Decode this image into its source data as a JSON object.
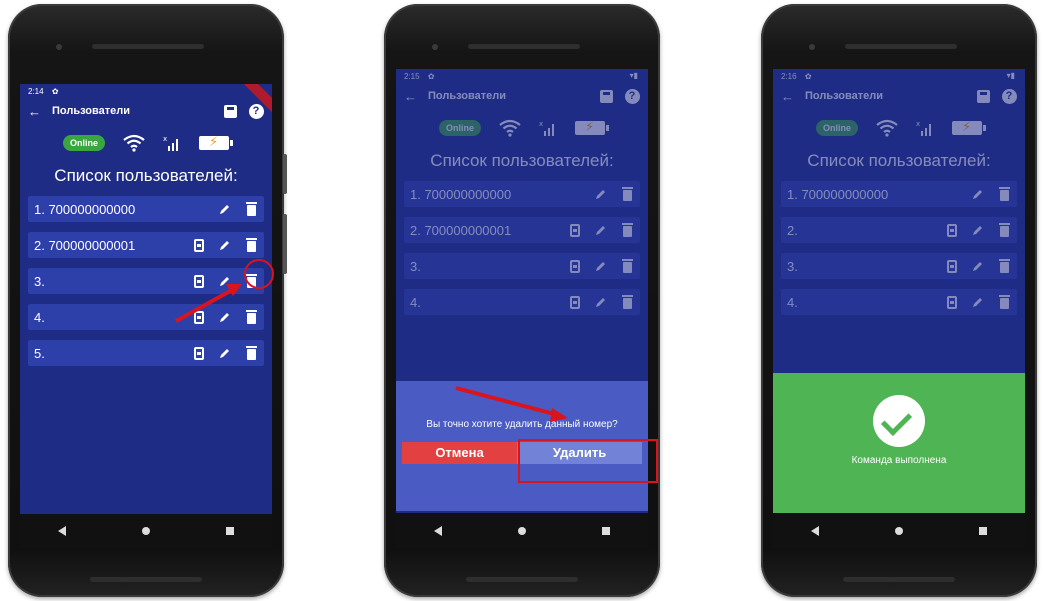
{
  "status_times": [
    "2:14",
    "2:15",
    "2:16"
  ],
  "appbar": {
    "title": "Пользователи",
    "back": "←",
    "help": "?"
  },
  "online_label": "Online",
  "list_title": "Список пользователей:",
  "screen1_rows": [
    {
      "label": "1. 700000000000",
      "contact": false
    },
    {
      "label": "2. 700000000001",
      "contact": true
    },
    {
      "label": "3.",
      "contact": true
    },
    {
      "label": "4.",
      "contact": true
    },
    {
      "label": "5.",
      "contact": true
    }
  ],
  "screen2_rows": [
    {
      "label": "1. 700000000000",
      "contact": false
    },
    {
      "label": "2. 700000000001",
      "contact": true
    },
    {
      "label": "3.",
      "contact": true
    },
    {
      "label": "4.",
      "contact": true
    }
  ],
  "screen3_rows": [
    {
      "label": "1. 700000000000",
      "contact": false
    },
    {
      "label": "2.",
      "contact": true
    },
    {
      "label": "3.",
      "contact": true
    },
    {
      "label": "4.",
      "contact": true
    }
  ],
  "dialog": {
    "question": "Вы точно хотите удалить данный номер?",
    "cancel": "Отмена",
    "delete": "Удалить"
  },
  "success_message": "Команда выполнена",
  "colors": {
    "screen_bg": "#1f2c86",
    "row_bg": "#2d3fa8",
    "online": "#3aa642",
    "annotation": "#d9141c",
    "success": "#4fb453"
  },
  "icons": [
    "back-arrow-icon",
    "settings-gear-icon",
    "save-icon",
    "help-icon",
    "wifi-icon",
    "signal-bars-icon",
    "battery-charging-icon",
    "contact-icon",
    "edit-pencil-icon",
    "delete-trash-icon",
    "check-icon"
  ]
}
